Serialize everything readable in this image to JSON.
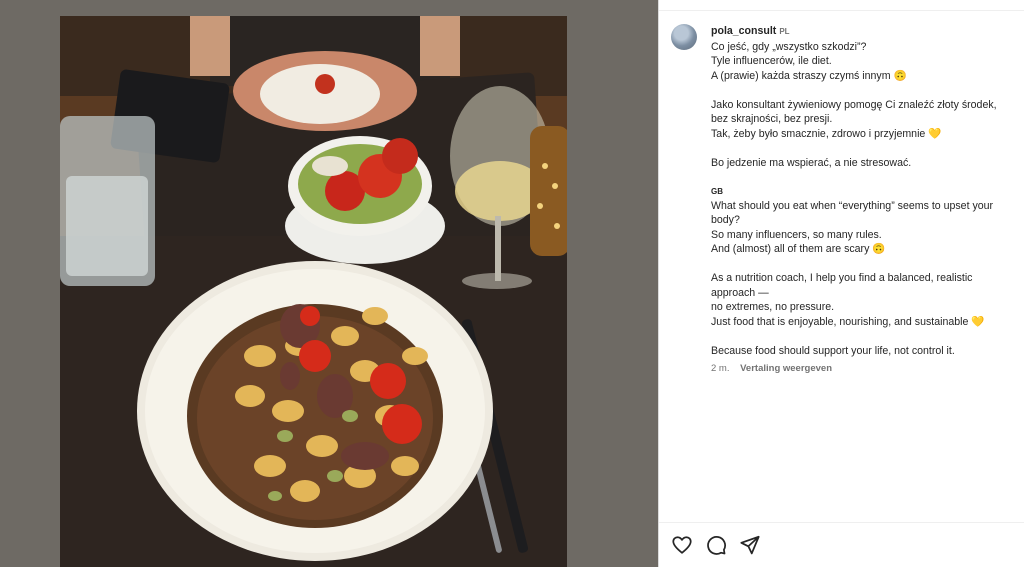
{
  "post": {
    "username": "pola_consult",
    "username_flag": "PL",
    "lines": [
      "Co jeść, gdy „wszystko szkodzi”?",
      "Tyle influencerów, ile diet.",
      "A (prawie) każda straszy czymś innym 🙃",
      "",
      "Jako konsultant żywieniowy pomogę Ci znaleźć złoty środek,",
      "bez skrajności, bez presji.",
      "Tak, żeby było smacznie, zdrowo i przyjemnie 💛",
      "",
      "Bo jedzenie ma wspierać, a nie stresować.",
      ""
    ],
    "flag_gb": "GB",
    "lines_en": [
      "What should you eat when “everything” seems to upset your",
      "body?",
      "So many influencers, so many rules.",
      "And (almost) all of them are scary 🙃",
      "",
      "As a nutrition coach, I help you find a balanced, realistic",
      "approach —",
      "no extremes, no pressure.",
      "Just food that is enjoyable, nourishing, and sustainable 💛",
      "",
      "Because food should support your life, not control it."
    ],
    "time": "2 m.",
    "translate_label": "Vertaling weergeven"
  },
  "actions": {
    "like_icon": "heart-icon",
    "comment_icon": "comment-icon",
    "share_icon": "share-icon"
  }
}
